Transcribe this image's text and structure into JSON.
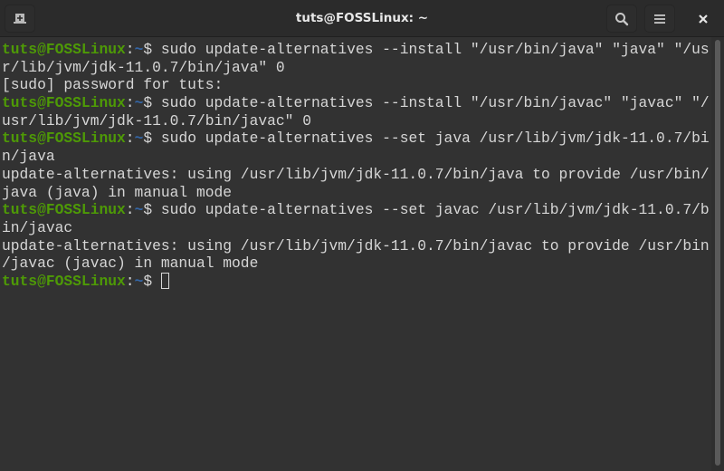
{
  "window": {
    "title": "tuts@FOSSLinux: ~",
    "buttons": {
      "new_tab": "new-tab-icon",
      "search": "search-icon",
      "menu": "hamburger-menu-icon",
      "close": "close-icon"
    }
  },
  "colors": {
    "prompt_user": "#4e9a06",
    "prompt_dir": "#3465a4",
    "text": "#d6d6d6",
    "background": "#323232"
  },
  "terminal": {
    "prompt": {
      "user_host": "tuts@FOSSLinux",
      "colon": ":",
      "dir": "~",
      "symbol": "$ "
    },
    "lines": [
      {
        "type": "cmd",
        "text": "sudo update-alternatives --install \"/usr/bin/java\" \"java\" \"/us"
      },
      {
        "type": "out",
        "text": "r/lib/jvm/jdk-11.0.7/bin/java\" 0"
      },
      {
        "type": "out",
        "text": "[sudo] password for tuts:"
      },
      {
        "type": "cmd",
        "text": "sudo update-alternatives --install \"/usr/bin/javac\" \"javac\" \"/"
      },
      {
        "type": "out",
        "text": "usr/lib/jvm/jdk-11.0.7/bin/javac\" 0"
      },
      {
        "type": "cmd",
        "text": "sudo update-alternatives --set java /usr/lib/jvm/jdk-11.0.7/bi"
      },
      {
        "type": "out",
        "text": "n/java"
      },
      {
        "type": "out",
        "text": "update-alternatives: using /usr/lib/jvm/jdk-11.0.7/bin/java to provide /usr/bin/"
      },
      {
        "type": "out",
        "text": "java (java) in manual mode"
      },
      {
        "type": "cmd",
        "text": "sudo update-alternatives --set javac /usr/lib/jvm/jdk-11.0.7/b"
      },
      {
        "type": "out",
        "text": "in/javac"
      },
      {
        "type": "out",
        "text": "update-alternatives: using /usr/lib/jvm/jdk-11.0.7/bin/javac to provide /usr/bin"
      },
      {
        "type": "out",
        "text": "/javac (javac) in manual mode"
      },
      {
        "type": "cmd",
        "text": "",
        "cursor": true
      }
    ]
  }
}
